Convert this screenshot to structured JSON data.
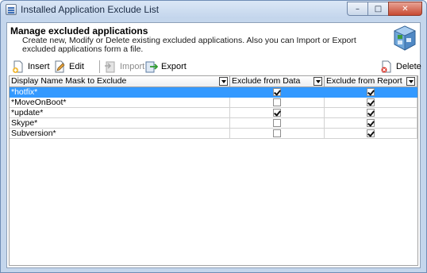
{
  "window": {
    "title": "Installed Application Exclude List",
    "buttons": {
      "minimize": "–",
      "maximize": "□",
      "close": "✕"
    }
  },
  "header": {
    "title": "Manage excluded applications",
    "description": "Create new, Modify or Delete existing excluded applications. Also you can Import or Export excluded applications form a file."
  },
  "toolbar": {
    "insert_label": "Insert",
    "edit_label": "Edit",
    "import_label": "Import",
    "export_label": "Export",
    "delete_label": "Delete"
  },
  "grid": {
    "columns": [
      "Display Name Mask to Exclude",
      "Exclude from Data",
      "Exclude from Report"
    ],
    "rows": [
      {
        "name": "*hotfix*",
        "exclude_data": true,
        "exclude_report": true,
        "selected": true
      },
      {
        "name": "*MoveOnBoot*",
        "exclude_data": false,
        "exclude_report": true,
        "selected": false
      },
      {
        "name": "*update*",
        "exclude_data": true,
        "exclude_report": true,
        "selected": false
      },
      {
        "name": "Skype*",
        "exclude_data": false,
        "exclude_report": true,
        "selected": false
      },
      {
        "name": "Subversion*",
        "exclude_data": false,
        "exclude_report": true,
        "selected": false
      }
    ]
  },
  "colors": {
    "selection": "#3399ff",
    "window_frame": "#c4d6ec"
  }
}
